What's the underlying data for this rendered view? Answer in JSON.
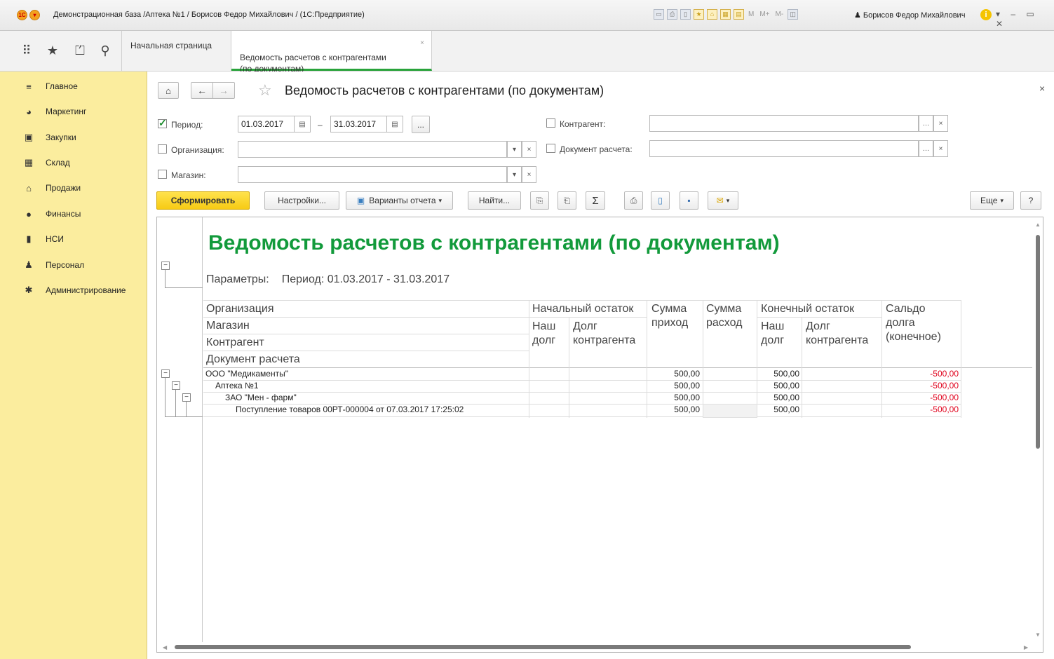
{
  "window": {
    "title": "Демонстрационная база /Аптека №1 / Борисов Федор Михайлович / (1С:Предприятие)",
    "user": "Борисов Федор Михайлович",
    "toolbar_texts": [
      "M",
      "M+",
      "M-"
    ]
  },
  "section_panel": {
    "tabs": [
      {
        "label": "Начальная страница"
      },
      {
        "label": "Ведомость расчетов с контрагентами\n(по документам)"
      }
    ]
  },
  "sidebar": {
    "items": [
      {
        "label": "Главное",
        "icon": "menu-lines-icon"
      },
      {
        "label": "Маркетинг",
        "icon": "pie-chart-icon"
      },
      {
        "label": "Закупки",
        "icon": "cart-icon"
      },
      {
        "label": "Склад",
        "icon": "warehouse-icon"
      },
      {
        "label": "Продажи",
        "icon": "basket-icon"
      },
      {
        "label": "Финансы",
        "icon": "ruble-coin-icon"
      },
      {
        "label": "НСИ",
        "icon": "book-icon"
      },
      {
        "label": "Персонал",
        "icon": "person-icon"
      },
      {
        "label": "Администрирование",
        "icon": "gear-icon"
      }
    ]
  },
  "form": {
    "title": "Ведомость расчетов с контрагентами (по документам)",
    "filters": {
      "period_label": "Период:",
      "period_checked": true,
      "date_from": "01.03.2017",
      "date_to": "31.03.2017",
      "dash": "–",
      "ellipsis": "...",
      "org_label": "Организация:",
      "org_value": "",
      "shop_label": "Магазин:",
      "shop_value": "",
      "counterparty_label": "Контрагент:",
      "counterparty_value": "",
      "doc_label": "Документ расчета:",
      "doc_value": ""
    },
    "commands": {
      "generate": "Сформировать",
      "settings": "Настройки...",
      "variants": "Варианты отчета",
      "find": "Найти...",
      "sum": "Σ",
      "more": "Еще",
      "help": "?"
    }
  },
  "report": {
    "title": "Ведомость расчетов с контрагентами (по документам)",
    "params_label": "Параметры:",
    "params_value": "Период: 01.03.2017 - 31.03.2017",
    "header": {
      "grouping": [
        "Организация",
        "Магазин",
        "Контрагент",
        "Документ расчета"
      ],
      "opening": "Начальный остаток",
      "opening_our": "Наш\nдолг",
      "opening_theirs": "Долг\nконтрагента",
      "income": "Сумма\nприход",
      "expense": "Сумма\nрасход",
      "closing": "Конечный остаток",
      "closing_our": "Наш\nдолг",
      "closing_theirs": "Долг\nконтрагента",
      "balance": "Сальдо\nдолга\n(конечное)"
    },
    "rows": [
      {
        "name": "ООО \"Медикаменты\"",
        "level": 0,
        "income": "500,00",
        "closing_our": "500,00",
        "balance": "-500,00"
      },
      {
        "name": "Аптека №1",
        "level": 1,
        "income": "500,00",
        "closing_our": "500,00",
        "balance": "-500,00"
      },
      {
        "name": "ЗАО \"Мен - фарм\"",
        "level": 2,
        "income": "500,00",
        "closing_our": "500,00",
        "balance": "-500,00"
      },
      {
        "name": "Поступление товаров 00РТ-000004 от 07.03.2017 17:25:02",
        "level": 3,
        "income": "500,00",
        "closing_our": "500,00",
        "balance": "-500,00"
      }
    ]
  },
  "colors": {
    "accent_green": "#129a3b",
    "negative_red": "#e0001b",
    "sidebar_yellow": "#fbed9e",
    "button_yellow": "#f7cb14"
  }
}
